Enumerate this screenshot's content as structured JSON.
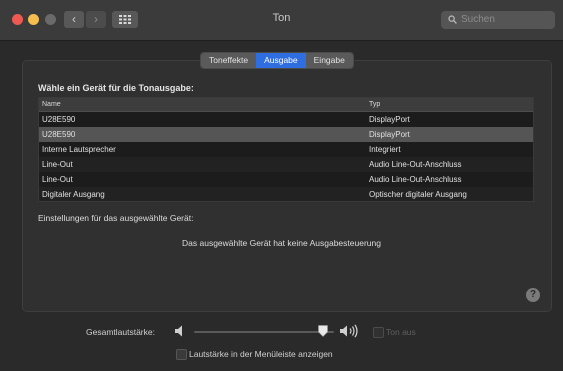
{
  "window": {
    "title": "Ton"
  },
  "toolbar": {
    "back_glyph": "‹",
    "forward_glyph": "›",
    "search_placeholder": "Suchen"
  },
  "tabs": [
    {
      "label": "Toneffekte",
      "active": false
    },
    {
      "label": "Ausgabe",
      "active": true
    },
    {
      "label": "Eingabe",
      "active": false
    }
  ],
  "output": {
    "heading": "Wähle ein Gerät für die Tonausgabe:",
    "columns": [
      "Name",
      "Typ"
    ],
    "rows": [
      {
        "name": "U28E590",
        "type": "DisplayPort"
      },
      {
        "name": "U28E590",
        "type": "DisplayPort"
      },
      {
        "name": "Interne Lautsprecher",
        "type": "Integriert"
      },
      {
        "name": "Line-Out",
        "type": "Audio Line-Out-Anschluss"
      },
      {
        "name": "Line-Out",
        "type": "Audio Line-Out-Anschluss"
      },
      {
        "name": "Digitaler Ausgang",
        "type": "Optischer digitaler Ausgang"
      }
    ],
    "selected_row": 1,
    "settings_label": "Einstellungen für das ausgewählte Gerät:",
    "no_control_text": "Das ausgewählte Gerät hat keine Ausgabesteuerung",
    "help_glyph": "?"
  },
  "volume": {
    "label": "Gesamtlautstärke:",
    "level": 0.92,
    "mute_label": "Ton aus",
    "mute_checked": false,
    "menu_label": "Lautstärke in der Menüleiste anzeigen",
    "menu_checked": false
  },
  "icons": {
    "grid": "grid-icon",
    "search": "search-icon",
    "speaker_low": "speaker-low-icon",
    "speaker_high": "speaker-high-icon",
    "help": "help-icon"
  },
  "colors": {
    "accent": "#2f6ee0",
    "close": "#ee5a52",
    "minimize": "#f4bd4e"
  }
}
